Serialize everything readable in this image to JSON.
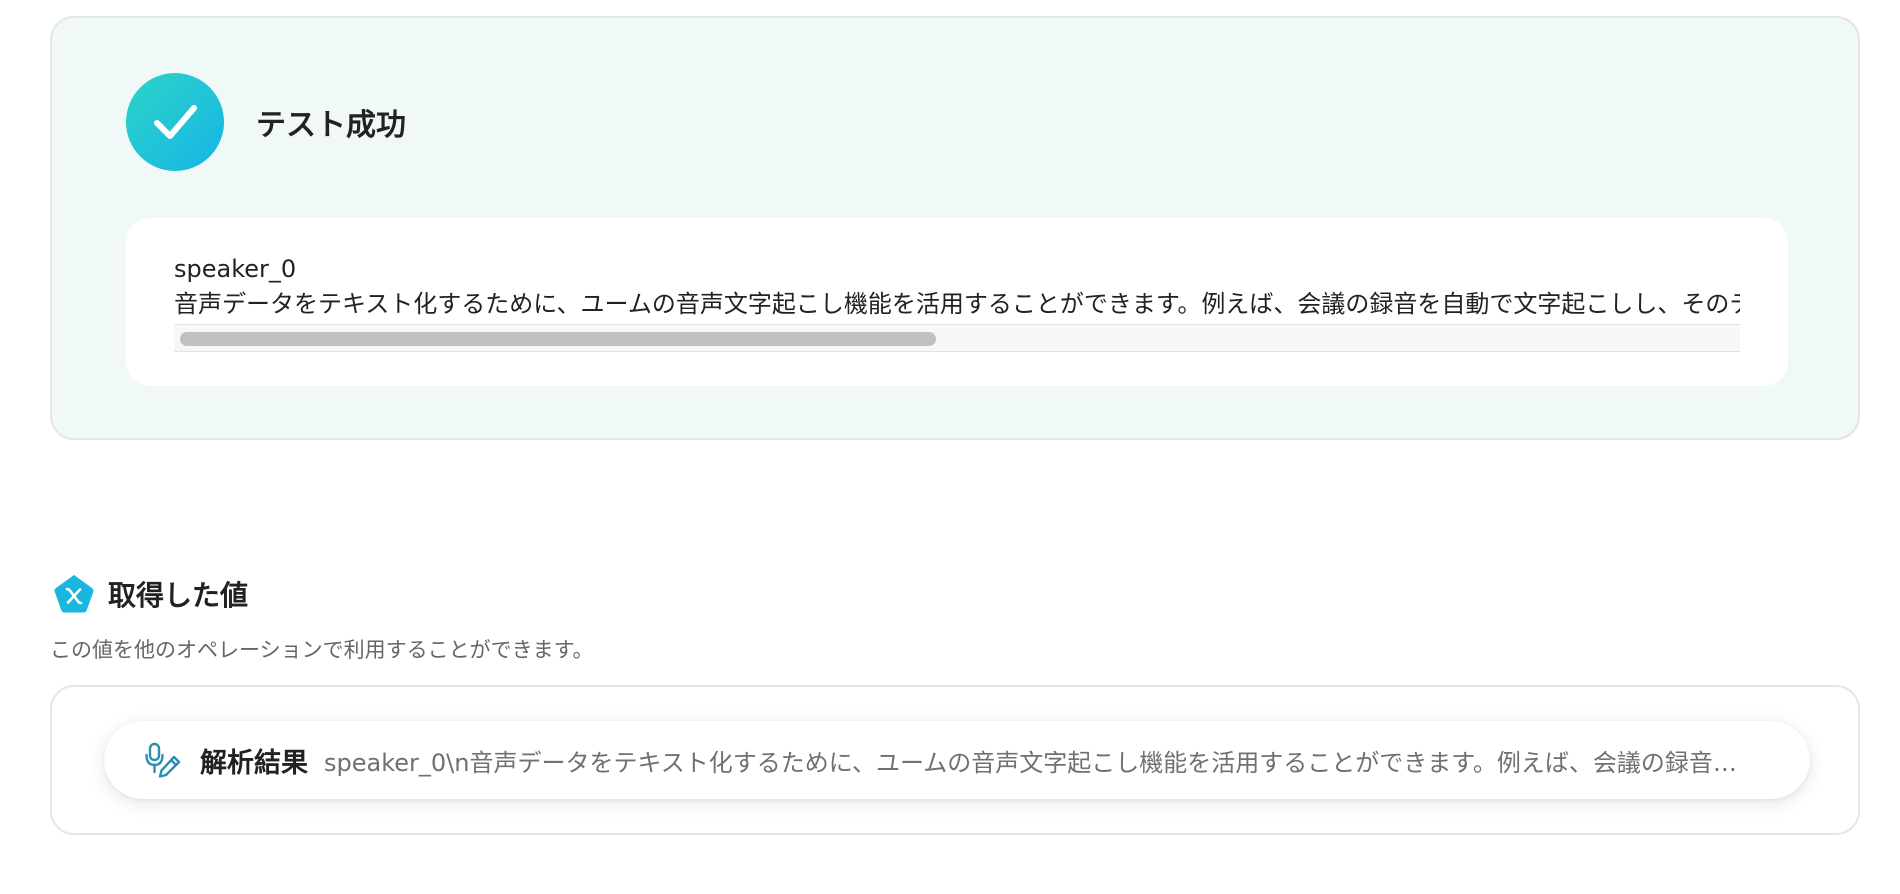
{
  "test_result": {
    "title": "テスト成功",
    "status_color": "#14b6e6",
    "output": {
      "speaker": "speaker_0",
      "text": "音声データをテキスト化するために、ユームの音声文字起こし機能を活用することができます。例えば、会議の録音を自動で文字起こしし、そのテキ"
    }
  },
  "retrieved_values": {
    "title": "取得した値",
    "icon": "variable-pentagon-icon",
    "accent_color": "#19b6e0",
    "description": "この値を他のオペレーションで利用することができます。",
    "items": [
      {
        "icon": "microphone-pen-icon",
        "label": "解析結果",
        "value": "speaker_0\\n音声データをテキスト化するために、ユームの音声文字起こし機能を活用することができます。例えば、会議の録音を自…"
      }
    ]
  }
}
